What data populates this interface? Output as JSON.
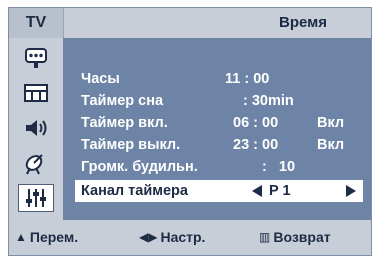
{
  "header": {
    "tv_label": "TV",
    "title": "Время"
  },
  "menu": {
    "rows": [
      {
        "label": "Часы",
        "value": "11 : 00"
      },
      {
        "label": "Таймер сна",
        "value": ": 30min"
      },
      {
        "label": "Таймер вкл.",
        "value": "06 : 00",
        "extra": "Вкл"
      },
      {
        "label": "Таймер выкл.",
        "value": "23 : 00",
        "extra": "Вкл"
      },
      {
        "label": "Громк. будильн.",
        "value": ":   10"
      }
    ],
    "selected": {
      "label": "Канал таймера",
      "value": "P 1"
    }
  },
  "sidebar": {
    "icons": [
      "input-icon",
      "picture-icon",
      "sound-icon",
      "channel-icon",
      "setup-icon"
    ],
    "active_index": 4
  },
  "footer": {
    "move": "Перем.",
    "adjust": "Настр.",
    "return": "Возврат"
  },
  "colors": {
    "panel": "#6d84a6",
    "chrome": "#c7ced8",
    "text_dark": "#1d2b45"
  }
}
